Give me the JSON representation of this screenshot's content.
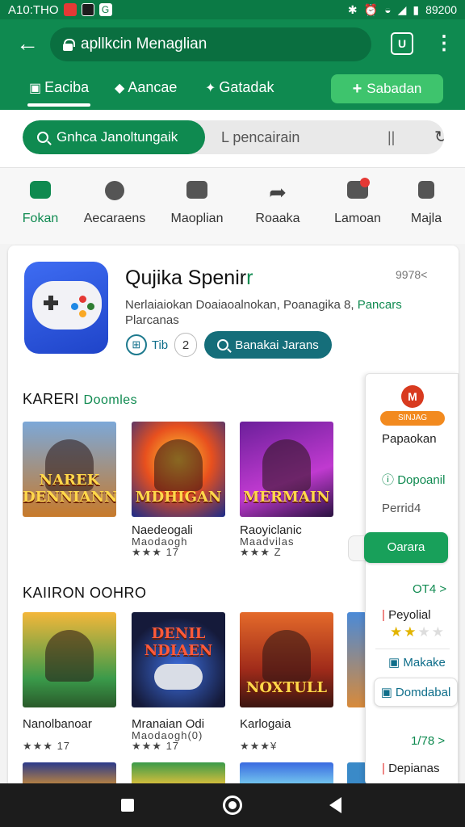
{
  "status_bar": {
    "time": "A10:THO",
    "battery_text": "89200"
  },
  "browser": {
    "url": "apllkcin Menaglian",
    "tabs_count": "U",
    "nav_tabs": [
      {
        "label": "Eaciba",
        "icon": "home-icon"
      },
      {
        "label": "Aancae",
        "icon": "tag-icon"
      },
      {
        "label": "Gatadak",
        "icon": "star-icon"
      }
    ],
    "primary_action": "Sabadan"
  },
  "search": {
    "chip_text": "Gnhca Janoltungaik",
    "placeholder": "L pencairain",
    "separator": "||"
  },
  "categories": [
    {
      "label": "Fokan",
      "icon": "store-icon",
      "active": true
    },
    {
      "label": "Aecaraens",
      "icon": "settings-icon"
    },
    {
      "label": "Maoplian",
      "icon": "chat-icon"
    },
    {
      "label": "Roaaka",
      "icon": "share-icon"
    },
    {
      "label": "Lamoan",
      "icon": "notification-icon",
      "badge": "1"
    },
    {
      "label": "Majla",
      "icon": "people-icon"
    }
  ],
  "app": {
    "title_main": "Qujika Spenir",
    "title_accent": "r",
    "meta": "9978<",
    "desc_prefix": "Nerlaiaiokan Doaiaoalnokan, Poanagika 8, ",
    "desc_accent": "Pancars",
    "desc_line2": "Plarcanas",
    "chip_rating": "Tib",
    "chip_count": "2",
    "action_label": "Banakai Jarans"
  },
  "section1": {
    "title": "KARERI",
    "subtitle": "Doomles",
    "tiles": [
      {
        "art_text": "NAREK DENNIANN",
        "title": "",
        "stars": ""
      },
      {
        "art_text": "MDHIGAN",
        "title": "Naedeogali",
        "subtitle": "Maodaogh",
        "stars": "★★★ 17"
      },
      {
        "art_text": "MERMAIN",
        "title": "Raoyiclanic",
        "subtitle": "Maadvilas",
        "stars": "★★★ Z"
      }
    ]
  },
  "section2": {
    "title": "KAIIRON OOHRO",
    "tiles": [
      {
        "art_text": "",
        "title": "Nanolbanoar",
        "stars": "★★★ 17"
      },
      {
        "art_text": "DENIL NDIAEN",
        "title": "Mranaian Odi",
        "subtitle": "Maodaogh(0)",
        "stars": "★★★ 17"
      },
      {
        "art_text": "NOXTULL",
        "title": "Karlogaia",
        "stars": "★★★¥"
      }
    ]
  },
  "side_panel": {
    "logo": "M",
    "badge": "SINJAG",
    "name": "Papaokan",
    "link": "Dopoanil",
    "period": "Perrid4",
    "cta": "Oarara",
    "count1": "OT4 >",
    "rating_label": "Peyolial",
    "rating": 2.5,
    "makake": "Makake",
    "download": "Domdabal",
    "count2": "1/78 >",
    "footer": "Depianas"
  },
  "colors": {
    "primary": "#0f8a50",
    "accent": "#3ec46d",
    "teal": "#156e7a",
    "badge_red": "#e53935"
  }
}
